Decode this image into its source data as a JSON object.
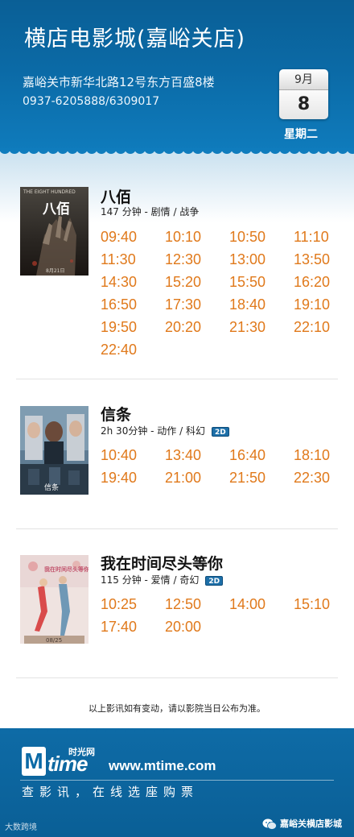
{
  "header": {
    "title": "横店电影城(嘉峪关店)",
    "address": "嘉峪关市新华北路12号东方百盛8楼",
    "phone": "0937-6205888/6309017"
  },
  "calendar": {
    "month": "9月",
    "day": "8",
    "weekday": "星期二"
  },
  "movies": [
    {
      "title": "八佰",
      "info": "147 分钟 - 剧情 / 战争",
      "poster_text": "八佰",
      "poster_caption": "THE EIGHT HUNDRED",
      "poster_date": "8月21日",
      "times": [
        "09:40",
        "10:10",
        "10:50",
        "11:10",
        "11:30",
        "12:30",
        "13:00",
        "13:50",
        "14:30",
        "15:20",
        "15:50",
        "16:20",
        "16:50",
        "17:30",
        "18:40",
        "19:10",
        "19:50",
        "20:20",
        "21:30",
        "22:10",
        "22:40"
      ]
    },
    {
      "title": "信条",
      "info": "2h 30分钟 - 动作 / 科幻",
      "badge": "2D",
      "poster_text": "信条",
      "times": [
        "10:40",
        "13:40",
        "16:40",
        "18:10",
        "19:40",
        "21:00",
        "21:50",
        "22:30"
      ]
    },
    {
      "title": "我在时间尽头等你",
      "info": "115 分钟 - 爱情 / 奇幻",
      "badge": "2D",
      "poster_text": "我在时间尽头等你",
      "poster_date": "08/25",
      "times": [
        "10:25",
        "12:50",
        "14:00",
        "15:10",
        "17:40",
        "20:00"
      ]
    }
  ],
  "notice": "以上影讯如有变动，请以影院当日公布为准。",
  "footer": {
    "logo_m": "M",
    "logo_time": "time",
    "logo_cn": "时光网",
    "site": "www.mtime.com",
    "slogan": "查影讯，在线选座购票",
    "watermark_left": "大数跨境",
    "watermark_right": "嘉峪关横店影城"
  },
  "colors": {
    "header_blue": "#0b6aa6",
    "showtime_orange": "#e0791b",
    "badge_blue": "#1d6fa8"
  }
}
